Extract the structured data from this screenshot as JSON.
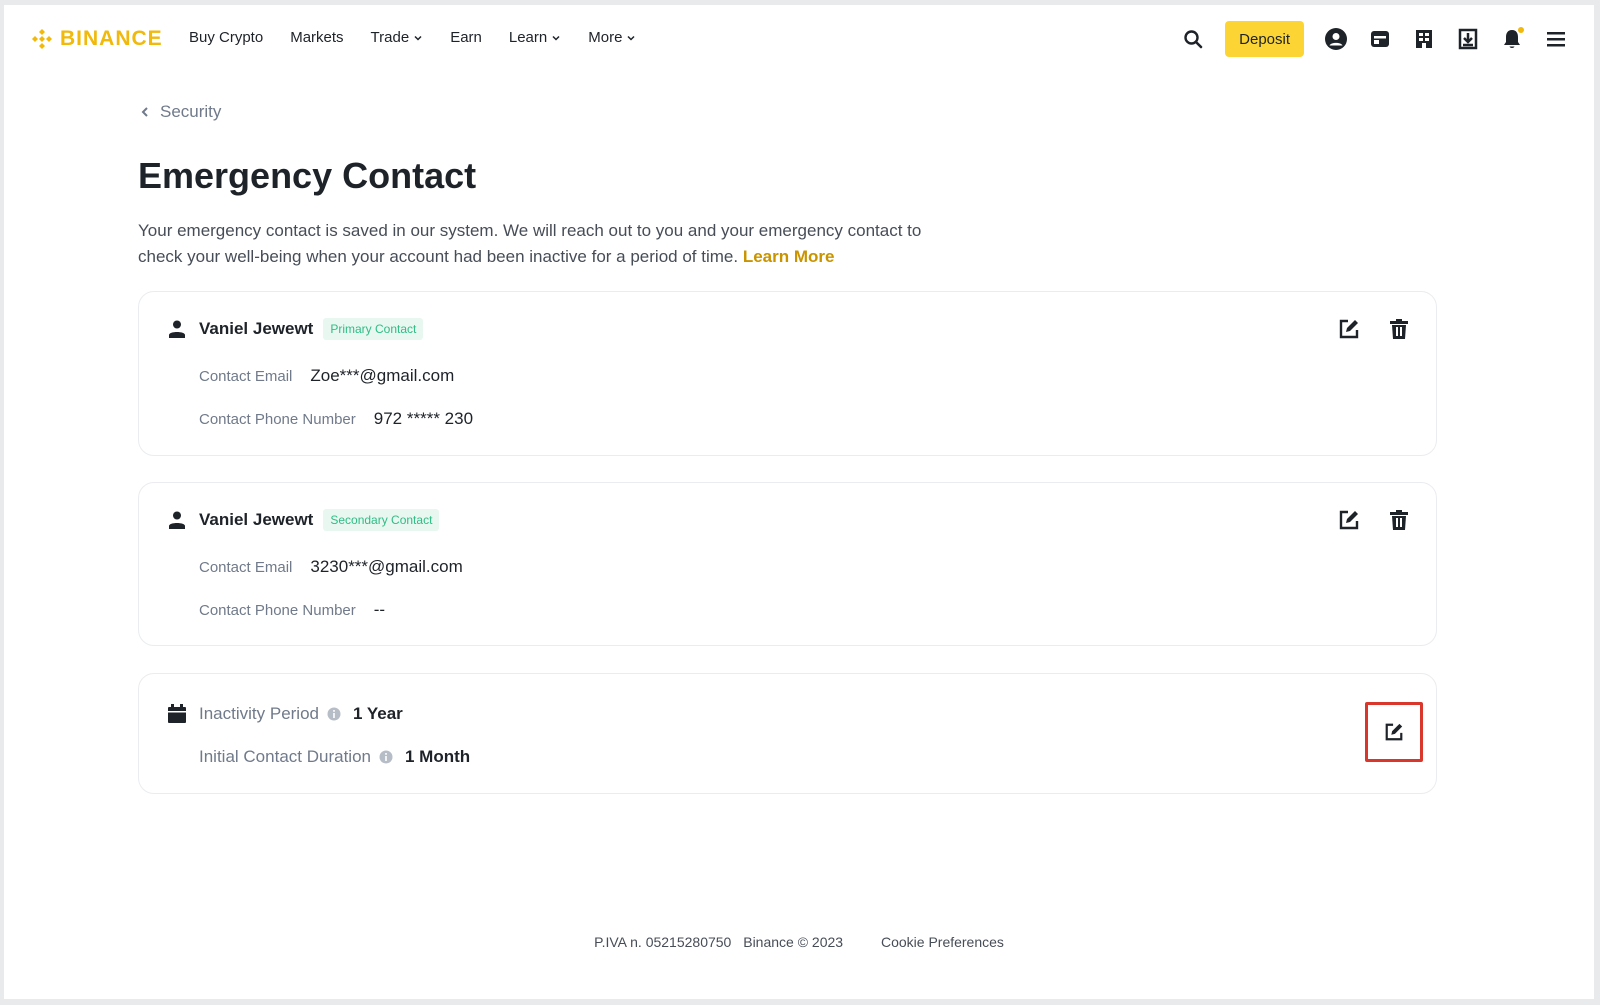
{
  "header": {
    "logo_text": "BINANCE",
    "brand_color": "#f0b90b",
    "nav": [
      {
        "label": "Buy Crypto",
        "has_dropdown": false
      },
      {
        "label": "Markets",
        "has_dropdown": false
      },
      {
        "label": "Trade",
        "has_dropdown": true
      },
      {
        "label": "Earn",
        "has_dropdown": false
      },
      {
        "label": "Learn",
        "has_dropdown": true
      },
      {
        "label": "More",
        "has_dropdown": true
      }
    ],
    "deposit_label": "Deposit",
    "icons": [
      "search-icon",
      "account-icon",
      "wallet-icon",
      "orders-icon",
      "download-icon",
      "notification-icon",
      "menu-icon"
    ]
  },
  "breadcrumb": {
    "label": "Security"
  },
  "page": {
    "title": "Emergency Contact",
    "description": "Your emergency contact is saved in our system. We will reach out to you and your emergency contact to check your well-being when your account had been inactive for a period of time.",
    "learn_more": "Learn More"
  },
  "contacts": [
    {
      "name": "Vaniel Jewewt",
      "badge": "Primary Contact",
      "email_label": "Contact Email",
      "email": "Zoe***@gmail.com",
      "phone_label": "Contact Phone Number",
      "phone": "972 ***** 230"
    },
    {
      "name": "Vaniel Jewewt",
      "badge": "Secondary Contact",
      "email_label": "Contact Email",
      "email": "3230***@gmail.com",
      "phone_label": "Contact Phone Number",
      "phone": "--"
    }
  ],
  "inactivity": {
    "period_label": "Inactivity Period",
    "period_value": "1 Year",
    "duration_label": "Initial Contact Duration",
    "duration_value": "1 Month",
    "highlight_color": "#d9372b"
  },
  "footer": {
    "piva": "P.IVA n. 05215280750",
    "copyright": "Binance © 2023",
    "cookie": "Cookie Preferences"
  }
}
